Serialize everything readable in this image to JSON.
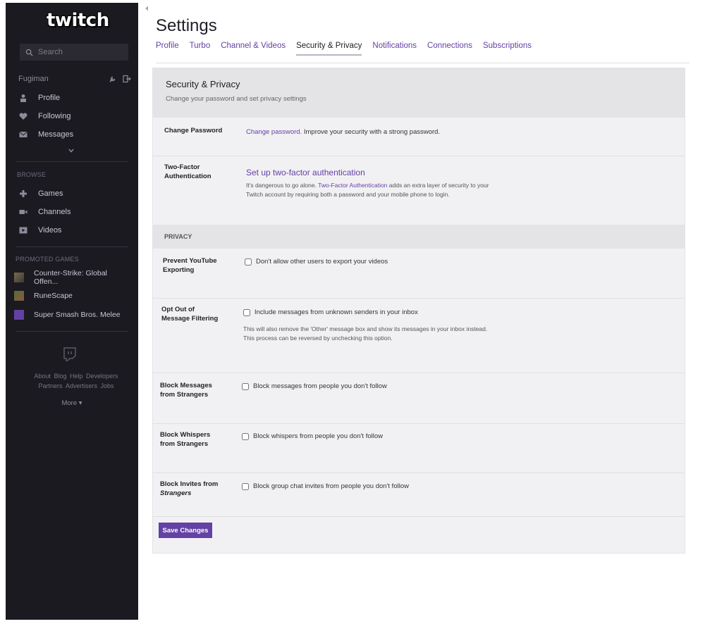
{
  "sidebar": {
    "logo": "twitch",
    "search_placeholder": "Search",
    "username": "Fugiman",
    "nav": [
      {
        "label": "Profile",
        "icon": "person-icon"
      },
      {
        "label": "Following",
        "icon": "heart-icon"
      },
      {
        "label": "Messages",
        "icon": "envelope-icon"
      }
    ],
    "browse_heading": "BROWSE",
    "browse": [
      {
        "label": "Games",
        "icon": "gamepad-icon"
      },
      {
        "label": "Channels",
        "icon": "camera-icon"
      },
      {
        "label": "Videos",
        "icon": "play-icon"
      }
    ],
    "promoted_heading": "PROMOTED GAMES",
    "promoted": [
      {
        "label": "Counter-Strike: Global Offen..."
      },
      {
        "label": "RuneScape"
      },
      {
        "label": "Super Smash Bros. Melee"
      }
    ],
    "footer_links_row1": [
      "About",
      "Blog",
      "Help",
      "Developers"
    ],
    "footer_links_row2": [
      "Partners",
      "Advertisers",
      "Jobs"
    ],
    "more_label": "More"
  },
  "main": {
    "title": "Settings",
    "tabs": [
      {
        "label": "Profile"
      },
      {
        "label": "Turbo"
      },
      {
        "label": "Channel & Videos"
      },
      {
        "label": "Security & Privacy"
      },
      {
        "label": "Notifications"
      },
      {
        "label": "Connections"
      },
      {
        "label": "Subscriptions"
      }
    ],
    "active_tab": "Security & Privacy",
    "panel": {
      "title": "Security & Privacy",
      "subtitle": "Change your password and set privacy settings",
      "change_password": {
        "label": "Change Password",
        "link": "Change password.",
        "text": "Improve your security with a strong password."
      },
      "two_factor": {
        "label_line1": "Two-Factor",
        "label_line2": "Authentication",
        "link": "Set up two-factor authentication",
        "help_pre": "It's dangerous to go alone.",
        "help_link": "Two-Factor Authentication",
        "help_post": "adds an extra layer of security to your Twitch account by requiring both a password and your mobile phone to login."
      },
      "privacy_heading": "PRIVACY",
      "youtube": {
        "label_line1": "Prevent YouTube",
        "label_line2": "Exporting",
        "checkbox": "Don't allow other users to export your videos"
      },
      "filtering": {
        "label_line1": "Opt Out of",
        "label_line2": "Message Filtering",
        "checkbox": "Include messages from unknown senders in your inbox",
        "help": "This will also remove the 'Other' message box and show its messages in your inbox instead. This process can be reversed by unchecking this option."
      },
      "block_messages": {
        "label_line1": "Block Messages",
        "label_line2": "from Strangers",
        "checkbox": "Block messages from people you don't follow"
      },
      "block_whispers": {
        "label_line1": "Block Whispers",
        "label_line2": "from Strangers",
        "checkbox": "Block whispers from people you don't follow"
      },
      "block_invites": {
        "label_line1": "Block Invites from",
        "label_line2": "Strangers",
        "checkbox": "Block group chat invites from people you don't follow"
      },
      "save_label": "Save Changes"
    }
  },
  "colors": {
    "accent": "#6441a4",
    "sidebar_bg": "#1b1a21",
    "panel_bg": "#f1f1f3",
    "panel_head_bg": "#e4e4e7"
  }
}
